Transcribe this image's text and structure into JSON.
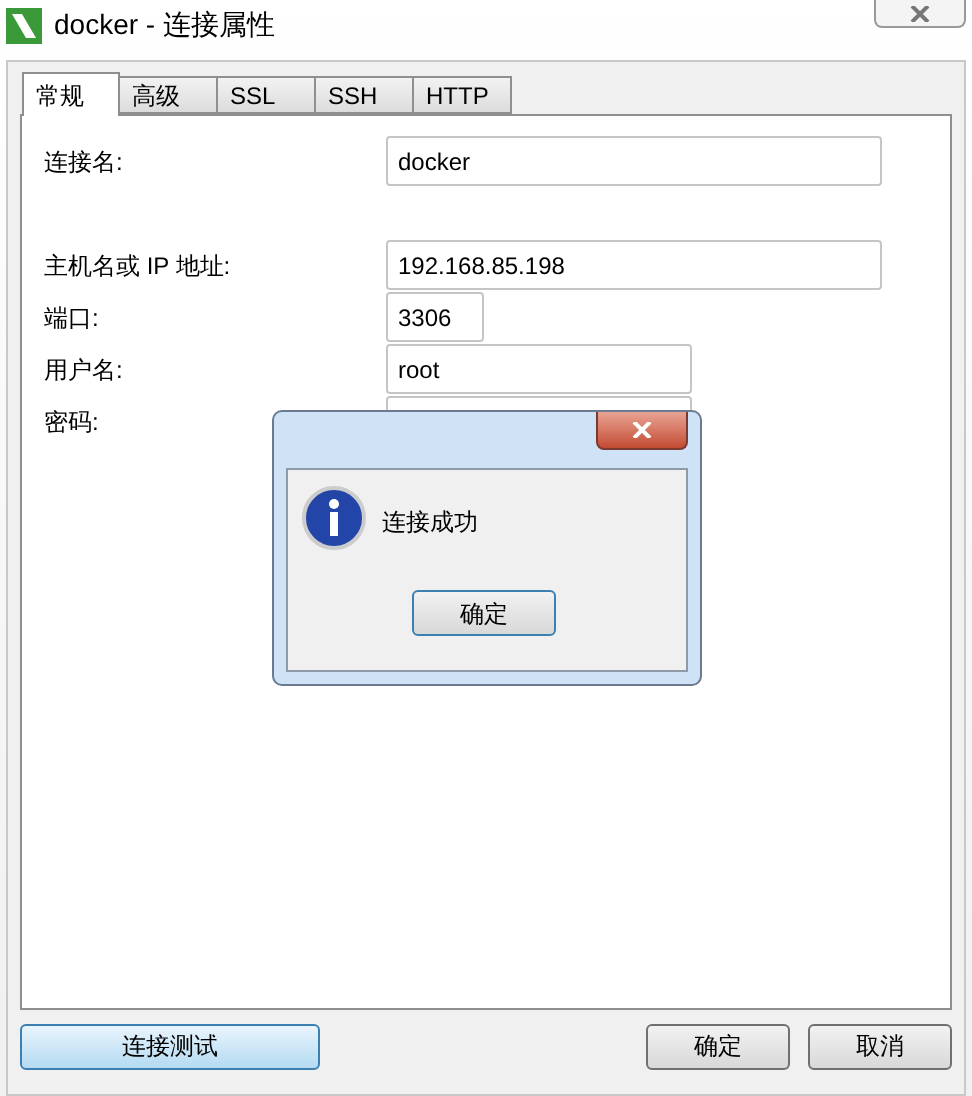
{
  "window": {
    "title": "docker - 连接属性"
  },
  "tabs": [
    {
      "label": "常规",
      "selected": true
    },
    {
      "label": "高级",
      "selected": false
    },
    {
      "label": "SSL",
      "selected": false
    },
    {
      "label": "SSH",
      "selected": false
    },
    {
      "label": "HTTP",
      "selected": false
    }
  ],
  "fields": [
    {
      "label": "连接名:",
      "value": "docker"
    },
    {
      "label": "主机名或 IP 地址:",
      "value": "192.168.85.198"
    },
    {
      "label": "端口:",
      "value": "3306"
    },
    {
      "label": "用户名:",
      "value": "root"
    },
    {
      "label": "密码:"
    }
  ],
  "buttons": [
    {
      "label": "连接测试",
      "default": true
    },
    {
      "label": "确定",
      "default": false
    },
    {
      "label": "取消",
      "default": false
    }
  ],
  "message_dialog": {
    "message": "连接成功",
    "button": "确定"
  }
}
